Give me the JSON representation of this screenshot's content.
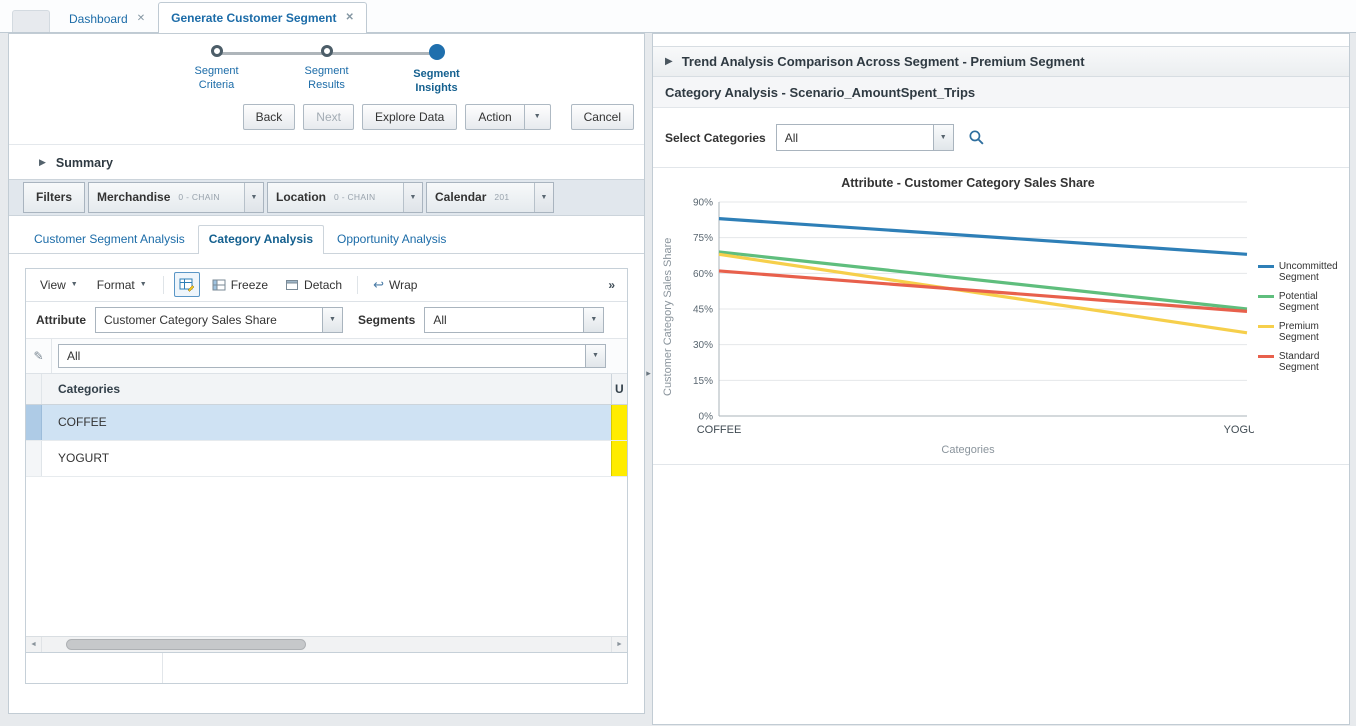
{
  "icons": {
    "close": "✕",
    "dropdown": "▼",
    "menu_caret": "▼",
    "disclosure_right": "▶",
    "overflow": "»",
    "scroll_left": "◄",
    "scroll_right": "►",
    "pencil": "✎",
    "splitter_arrow": "▸",
    "wrap": "↩"
  },
  "window_tabs": [
    {
      "label": "Dashboard"
    },
    {
      "label": "Generate Customer Segment"
    }
  ],
  "stepper": {
    "steps": [
      {
        "label": "Segment Criteria"
      },
      {
        "label": "Segment Results"
      },
      {
        "label": "Segment Insights"
      }
    ]
  },
  "actions": {
    "back": "Back",
    "next": "Next",
    "explore_data": "Explore Data",
    "action": "Action",
    "cancel": "Cancel"
  },
  "summary": {
    "label": "Summary"
  },
  "filter_bar": {
    "filters_label": "Filters",
    "items": [
      {
        "label": "Merchandise",
        "value": "0 - CHAIN"
      },
      {
        "label": "Location",
        "value": "0 - CHAIN"
      },
      {
        "label": "Calendar",
        "value": "201"
      }
    ]
  },
  "analysis_tabs": [
    {
      "label": "Customer Segment Analysis"
    },
    {
      "label": "Category Analysis"
    },
    {
      "label": "Opportunity Analysis"
    }
  ],
  "grid": {
    "toolbar": {
      "view": "View",
      "format": "Format",
      "freeze": "Freeze",
      "detach": "Detach",
      "wrap": "Wrap"
    },
    "attribute_label": "Attribute",
    "attribute_value": "Customer Category Sales Share",
    "segments_label": "Segments",
    "segments_value": "All",
    "qbe_filter_value": "All",
    "columns": {
      "category": "Categories",
      "clipped": "U"
    },
    "rows": [
      {
        "category": "COFFEE"
      },
      {
        "category": "YOGURT"
      }
    ]
  },
  "right_panel": {
    "header": "Trend Analysis Comparison Across Segment - Premium Segment",
    "subheader": "Category Analysis - Scenario_AmountSpent_Trips",
    "select_categories_label": "Select Categories",
    "select_categories_value": "All"
  },
  "chart_data": {
    "type": "line",
    "title": "Attribute - Customer Category Sales Share",
    "xlabel": "Categories",
    "ylabel": "Customer Category Sales Share",
    "categories": [
      "COFFEE",
      "YOGURT"
    ],
    "series": [
      {
        "name": "Uncommitted Segment",
        "color": "#2e7fb7",
        "values": [
          83,
          68
        ]
      },
      {
        "name": "Potential Segment",
        "color": "#5fbe7d",
        "values": [
          69,
          45
        ]
      },
      {
        "name": "Premium Segment",
        "color": "#f6cf4b",
        "values": [
          68,
          35
        ]
      },
      {
        "name": "Standard Segment",
        "color": "#e8604c",
        "values": [
          61,
          44
        ]
      }
    ],
    "ylim": [
      0,
      90
    ],
    "yticks": [
      0,
      15,
      30,
      45,
      60,
      75,
      90
    ],
    "ytick_suffix": "%",
    "grid": true,
    "legend_position": "right"
  }
}
